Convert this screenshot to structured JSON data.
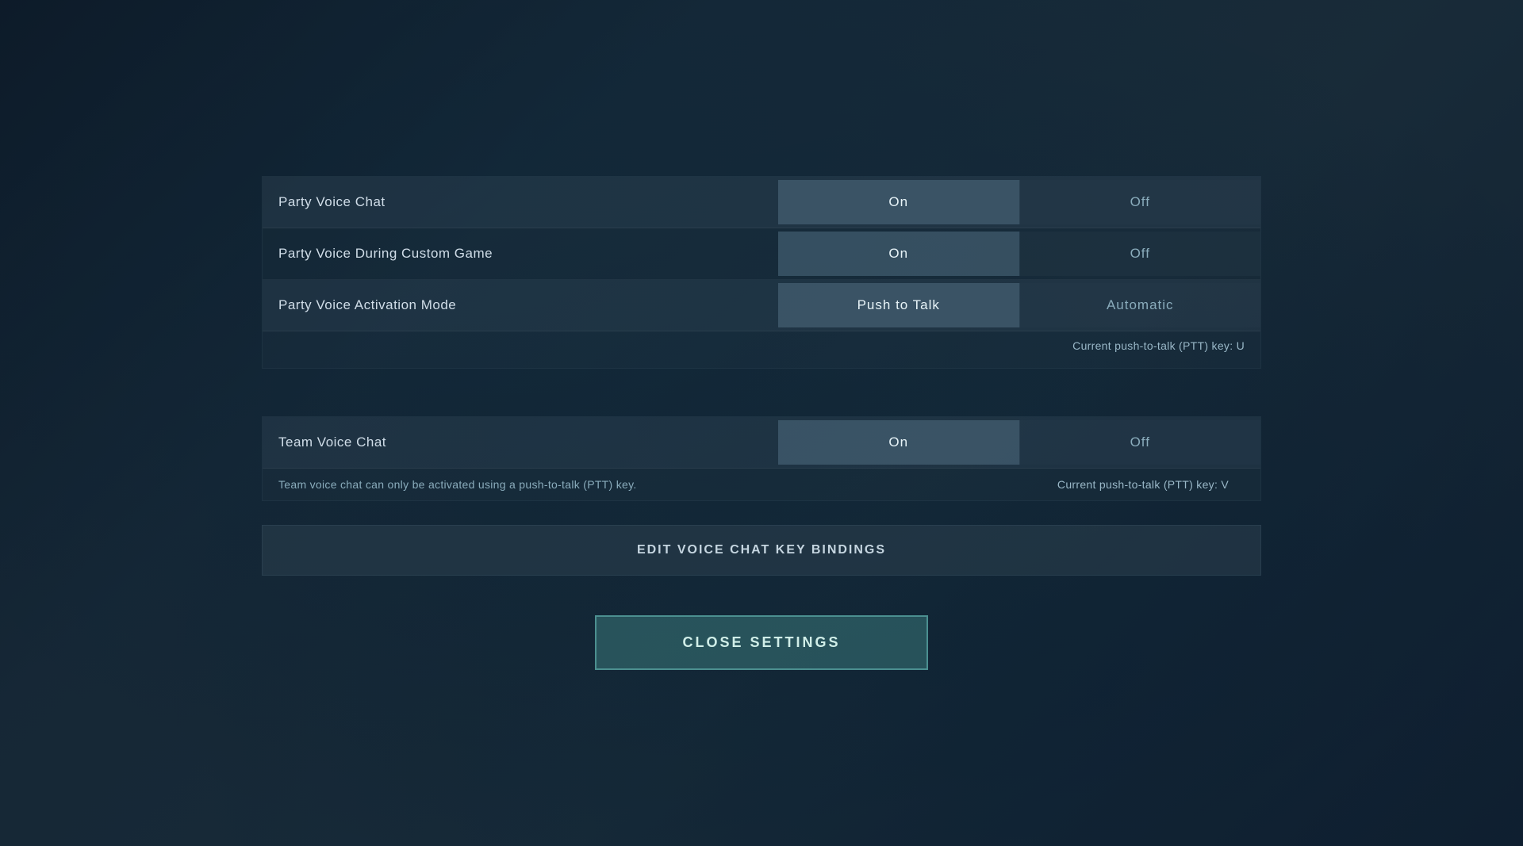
{
  "settings": {
    "party_group": {
      "party_voice_chat": {
        "label": "Party Voice Chat",
        "on_label": "On",
        "off_label": "Off",
        "active": "on"
      },
      "party_voice_custom_game": {
        "label": "Party Voice During Custom Game",
        "on_label": "On",
        "off_label": "Off",
        "active": "on"
      },
      "party_voice_activation": {
        "label": "Party Voice Activation Mode",
        "push_to_talk_label": "Push to Talk",
        "automatic_label": "Automatic",
        "active": "push_to_talk"
      },
      "ptt_key_info": "Current push-to-talk (PTT) key: U"
    },
    "team_group": {
      "team_voice_chat": {
        "label": "Team Voice Chat",
        "on_label": "On",
        "off_label": "Off",
        "active": "on"
      },
      "team_info_left": "Team voice chat can only be activated using a push-to-talk (PTT) key.",
      "team_ptt_key_info": "Current push-to-talk (PTT) key: V"
    },
    "edit_bindings_label": "EDIT VOICE CHAT KEY BINDINGS",
    "close_settings_label": "CLOSE SETTINGS"
  }
}
